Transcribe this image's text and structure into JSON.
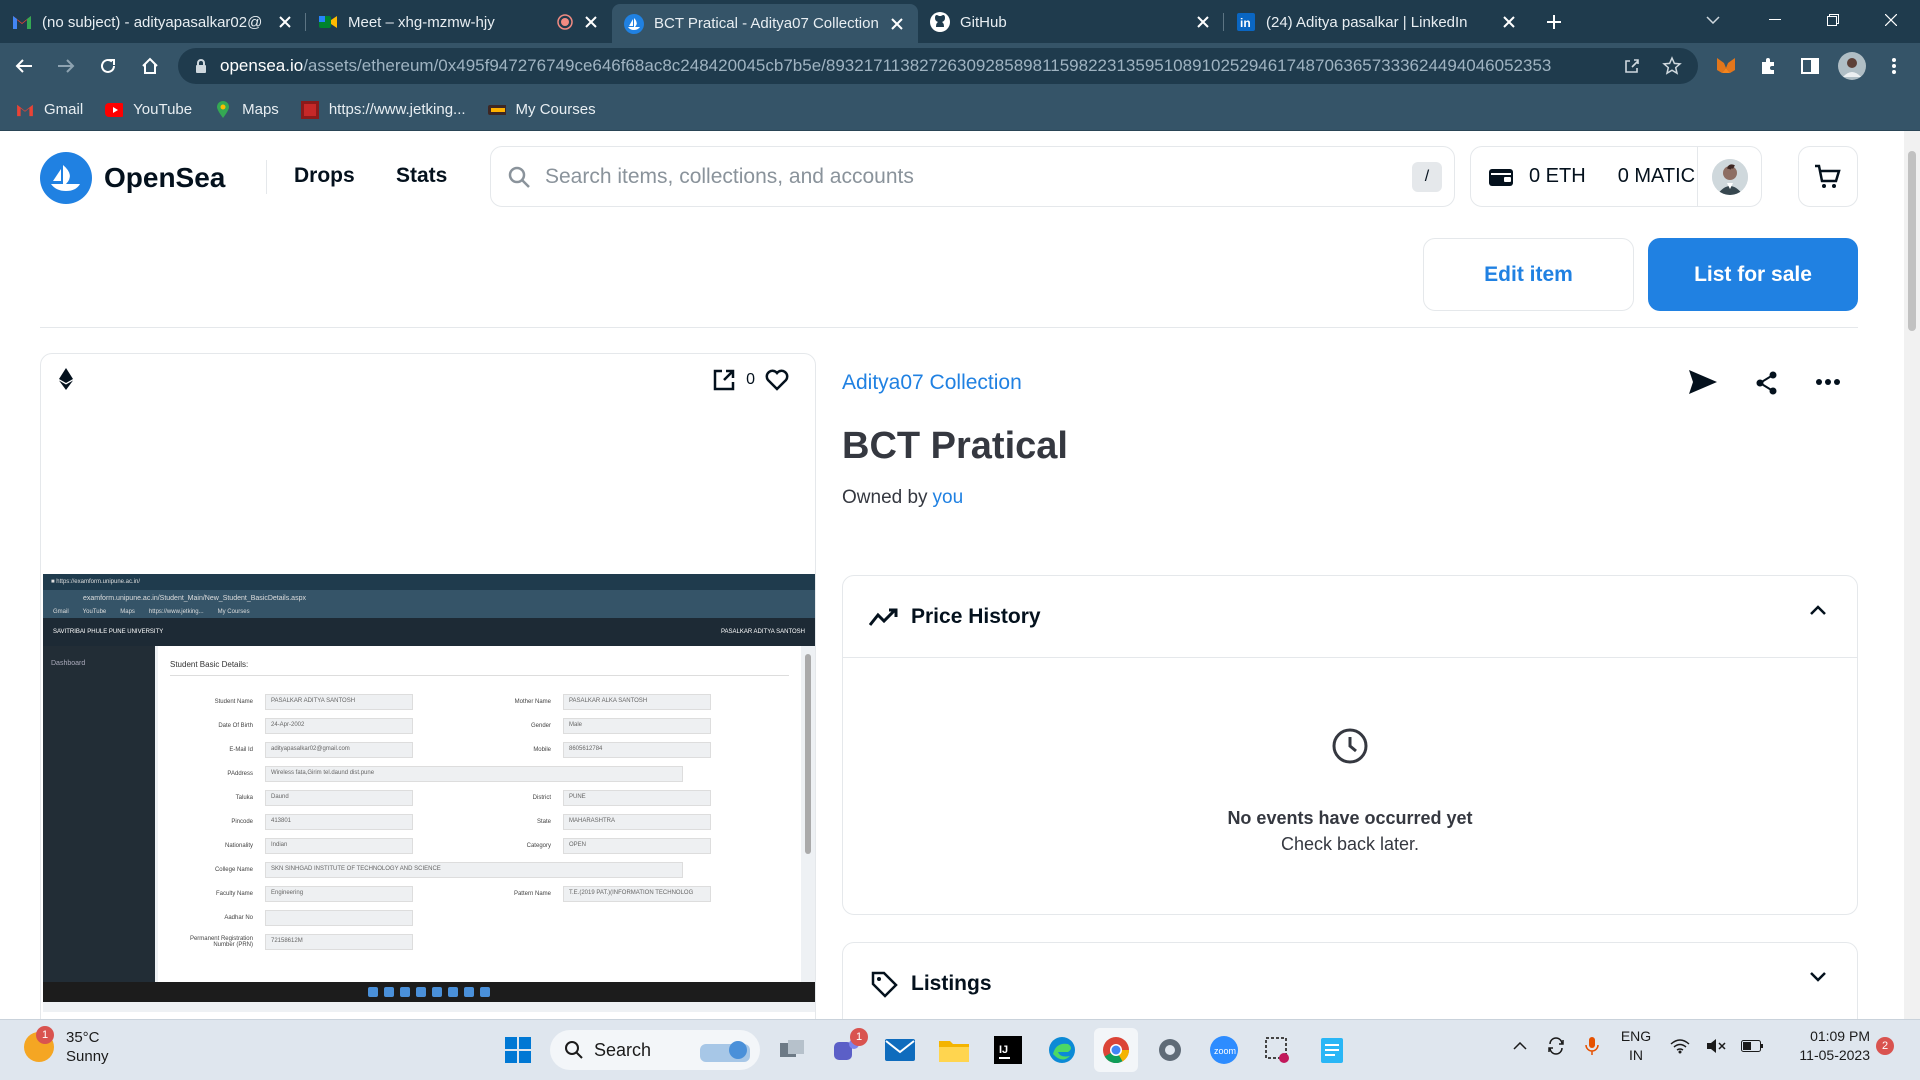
{
  "browser": {
    "tabs": [
      {
        "title": "(no subject) - adityapasalkar02@",
        "icon": "gmail-icon"
      },
      {
        "title": "Meet – xhg-mzmw-hjy",
        "icon": "meet-icon",
        "recording": true
      },
      {
        "title": "BCT Pratical - Aditya07 Collection",
        "icon": "opensea-icon",
        "active": true
      },
      {
        "title": "GitHub",
        "icon": "github-icon"
      },
      {
        "title": "(24) Aditya pasalkar | LinkedIn",
        "icon": "linkedin-icon"
      }
    ],
    "url_host": "opensea.io",
    "url_path": "/assets/ethereum/0x495f947276749ce646f68ac8c248420045cb7b5e/89321711382726309285898115982231359510891025294617487063657333624494046052353",
    "bookmarks": [
      "Gmail",
      "YouTube",
      "Maps",
      "https://www.jetking...",
      "My Courses"
    ]
  },
  "nav": {
    "brand": "OpenSea",
    "links": [
      "Drops",
      "Stats"
    ],
    "search_placeholder": "Search items, collections, and accounts",
    "search_shortcut": "/",
    "eth_balance": "0 ETH",
    "matic_balance": "0 MATIC"
  },
  "actions": {
    "edit_label": "Edit item",
    "list_label": "List for sale"
  },
  "media": {
    "chain_icon": "ethereum-icon",
    "likes": "0",
    "screenshot": {
      "title": "Student Basic Details:",
      "user": "PASALKAR ADITYA SANTOSH",
      "sidebar_item": "Dashboard",
      "rows": [
        {
          "l1": "Student Name",
          "v1": "PASALKAR ADITYA SANTOSH",
          "l2": "Mother Name",
          "v2": "PASALKAR ALKA SANTOSH"
        },
        {
          "l1": "Date Of Birth",
          "v1": "24-Apr-2002",
          "l2": "Gender",
          "v2": "Male"
        },
        {
          "l1": "E-Mail Id",
          "v1": "adityapasalkar02@gmail.com",
          "l2": "Mobile",
          "v2": "8605612784"
        },
        {
          "l1": "PAddress",
          "wide": "Wireless fata,Girim tel.daund dist.pune"
        },
        {
          "l1": "Taluka",
          "v1": "Daund",
          "l2": "District",
          "v2": "PUNE"
        },
        {
          "l1": "Pincode",
          "v1": "413801",
          "l2": "State",
          "v2": "MAHARASHTRA"
        },
        {
          "l1": "Nationality",
          "v1": "Indian",
          "l2": "Category",
          "v2": "OPEN"
        },
        {
          "l1": "College Name",
          "wide": "SKN SINHGAD INSTITUTE OF TECHNOLOGY AND SCIENCE"
        },
        {
          "l1": "Faculty Name",
          "v1": "Engineering",
          "l2": "Pattern Name",
          "v2": "T.E.(2019 PAT.)(INFORMATION TECHNOLOG"
        },
        {
          "l1": "Aadhar No",
          "v1": ""
        },
        {
          "l1": "Permanent Registration Number (PRN)",
          "v1": "72158612M"
        }
      ]
    }
  },
  "item": {
    "collection": "Aditya07 Collection",
    "name": "BCT Pratical",
    "owned_by_label": "Owned by",
    "owner": "you"
  },
  "price_history": {
    "title": "Price History",
    "empty_title": "No events have occurred yet",
    "empty_sub": "Check back later."
  },
  "listings": {
    "title": "Listings"
  },
  "taskbar": {
    "temperature": "35°C",
    "weather": "Sunny",
    "weather_badge": "1",
    "search_label": "Search",
    "teams_badge": "1",
    "lang_line1": "ENG",
    "lang_line2": "IN",
    "time": "01:09 PM",
    "date": "11-05-2023",
    "notifications": "2"
  }
}
